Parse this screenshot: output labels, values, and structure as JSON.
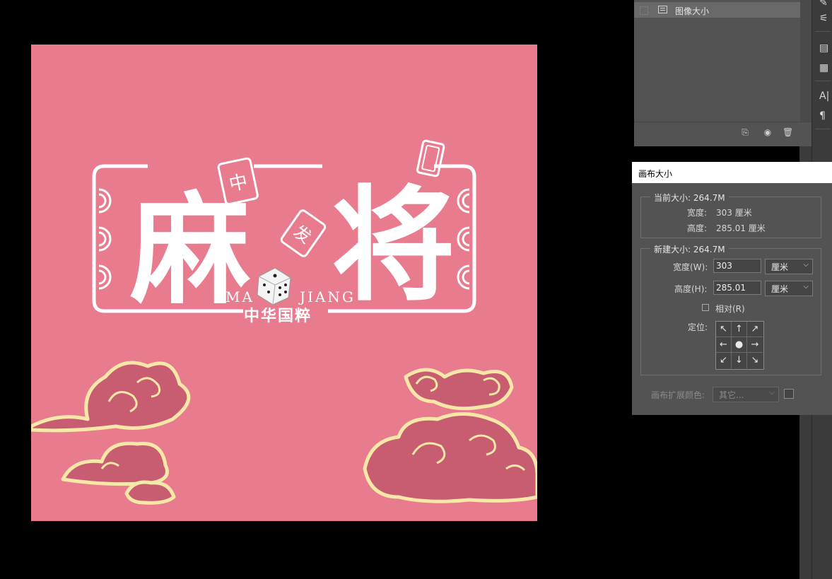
{
  "history_panel": {
    "items": [
      {
        "label": "图像大小"
      }
    ],
    "footer_icons": [
      "new-document-from-state-icon",
      "camera-icon",
      "trash-icon"
    ]
  },
  "right_strip": {
    "icons": [
      "brush-icon",
      "adjust-sliders-icon",
      "properties-icon",
      "notes-icon",
      "character-icon",
      "paragraph-icon"
    ]
  },
  "canvas_art": {
    "title_left": "麻",
    "title_right": "将",
    "tile_char": "中",
    "tile_char2": "发",
    "roman_left": "MA",
    "roman_right": "JIANG",
    "subtitle": "中华国粹",
    "background_color": "#e97b8f",
    "cloud_color": "#c85d72",
    "cloud_outline": "#f7e8a8"
  },
  "dialog": {
    "title": "画布大小",
    "current": {
      "legend": "当前大小: 264.7M",
      "width_label": "宽度:",
      "width_value": "303 厘米",
      "height_label": "高度:",
      "height_value": "285.01 厘米"
    },
    "new": {
      "legend": "新建大小: 264.7M",
      "width_label": "宽度(W):",
      "width_value": "303",
      "width_unit": "厘米",
      "height_label": "高度(H):",
      "height_value": "285.01",
      "height_unit": "厘米",
      "relative_label": "相对(R)",
      "relative_checked": false,
      "anchor_label": "定位:"
    },
    "extension_color_label": "画布扩展颜色:",
    "extension_color_value": "其它..."
  }
}
